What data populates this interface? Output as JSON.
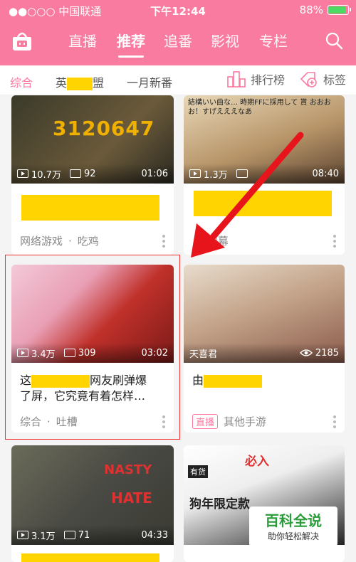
{
  "status": {
    "carrier": "●●○○○ 中国联通",
    "time": "下午12:44",
    "battery": "88%",
    "battery_level": 0.88
  },
  "nav": {
    "tabs": [
      {
        "label": "直播"
      },
      {
        "label": "推荐"
      },
      {
        "label": "追番"
      },
      {
        "label": "影视"
      },
      {
        "label": "专栏"
      }
    ]
  },
  "subnav": {
    "comprehensive": "综合",
    "game_prefix": "英",
    "game_suffix": "盟",
    "new_month": "一月新番",
    "ranking": "排行榜",
    "tags": "标签"
  },
  "cards": [
    {
      "views": "10.7万",
      "danmaku": "92",
      "duration": "01:06",
      "cat": "网络游戏",
      "sub": "吃鸡",
      "overlay": "3120647"
    },
    {
      "views": "1.3万",
      "danmaku": "",
      "duration": "08:40",
      "cat": "",
      "sub": "弹幕",
      "overlay": "結構いい曲な…  時期FFに採用して 貰 おおおお！すげえええなあ"
    },
    {
      "views": "3.4万",
      "danmaku": "309",
      "duration": "03:02",
      "title_a": "这",
      "title_b": "网友刷弹爆",
      "title_c": "了屏，它究竟有着怎样…",
      "cat": "综合",
      "sub": "吐槽"
    },
    {
      "streamer": "天喜君",
      "viewers": "2185",
      "badge": "直播",
      "cat": "其他手游",
      "title_a": "由"
    },
    {
      "views": "3.1万",
      "danmaku": "71",
      "duration": "04:33",
      "overlay1": "NASTY",
      "overlay2": "HATE"
    },
    {
      "overlay1": "必入",
      "overlay2": "狗年限定款",
      "corner": "有货"
    }
  ],
  "watermark": {
    "big": "百科全说",
    "small": "助你轻松解决"
  },
  "colors": {
    "accent": "#f97ba0",
    "arrow": "#e8141b",
    "redaction": "#ffd400"
  }
}
